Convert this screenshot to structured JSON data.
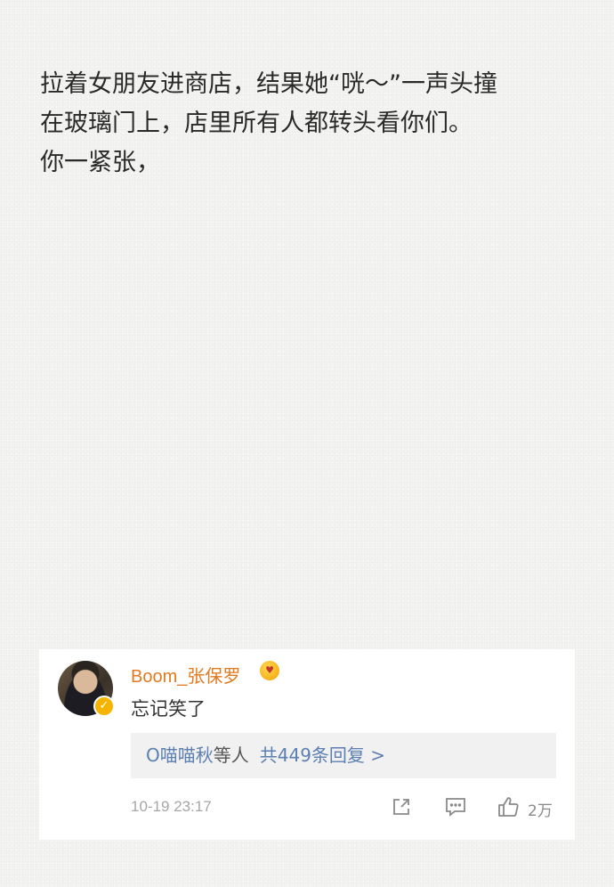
{
  "post": {
    "lines": [
      "拉着女朋友进商店，结果她“咣～”一声头撞",
      "在玻璃门上，店里所有人都转头看你们。",
      "你一紧张，"
    ]
  },
  "comment": {
    "username": "Boom_张保罗",
    "text": "忘记笑了",
    "replies": {
      "first_user": "O喵喵秋",
      "others_label": "等人",
      "count_label": "共449条回复 >"
    },
    "timestamp": "10-19 23:17",
    "like_count": "2万",
    "icons": {
      "avatar": "avatar",
      "verified": "verified-badge-icon",
      "emoji": "grinning-emoji-icon",
      "share": "share-icon",
      "comment": "comment-icon",
      "like": "thumbs-up-icon"
    },
    "colors": {
      "username": "#e07a1f",
      "link": "#5b7fb1",
      "verified": "#f5b400"
    }
  }
}
